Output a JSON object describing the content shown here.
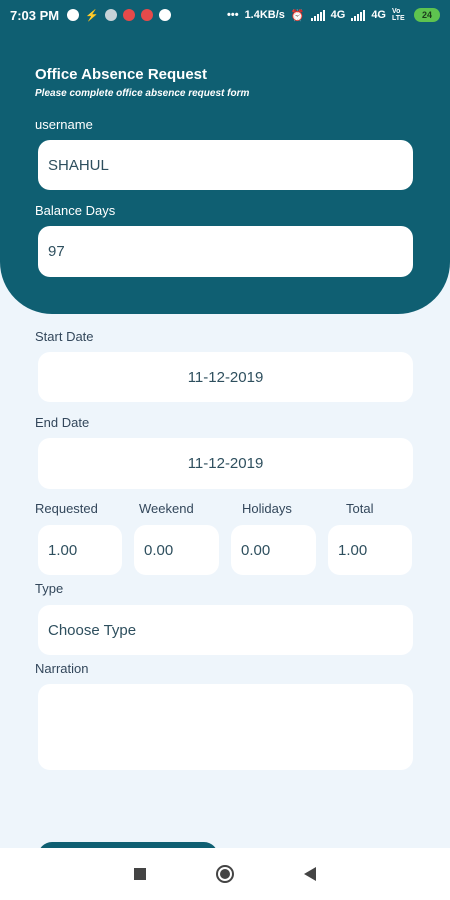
{
  "status_bar": {
    "time": "7:03 PM",
    "network_speed": "1.4KB/s",
    "network_1": "4G",
    "network_2": "4G",
    "volte": "Vo LTE",
    "battery": "24"
  },
  "header": {
    "title": "Office Absence Request",
    "subtitle": "Please complete office absence request form"
  },
  "form": {
    "username_label": "username",
    "username_value": "SHAHUL",
    "balance_label": "Balance Days",
    "balance_value": "97",
    "start_date_label": "Start Date",
    "start_date_value": "11-12-2019",
    "end_date_label": "End Date",
    "end_date_value": "11-12-2019",
    "requested_label": "Requested",
    "requested_value": "1.00",
    "weekend_label": "Weekend",
    "weekend_value": "0.00",
    "holidays_label": "Holidays",
    "holidays_value": "0.00",
    "total_label": "Total",
    "total_value": "1.00",
    "type_label": "Type",
    "type_placeholder": "Choose Type",
    "narration_label": "Narration",
    "narration_value": ""
  },
  "colors": {
    "primary": "#0f5f72",
    "background": "#eef5fb"
  }
}
